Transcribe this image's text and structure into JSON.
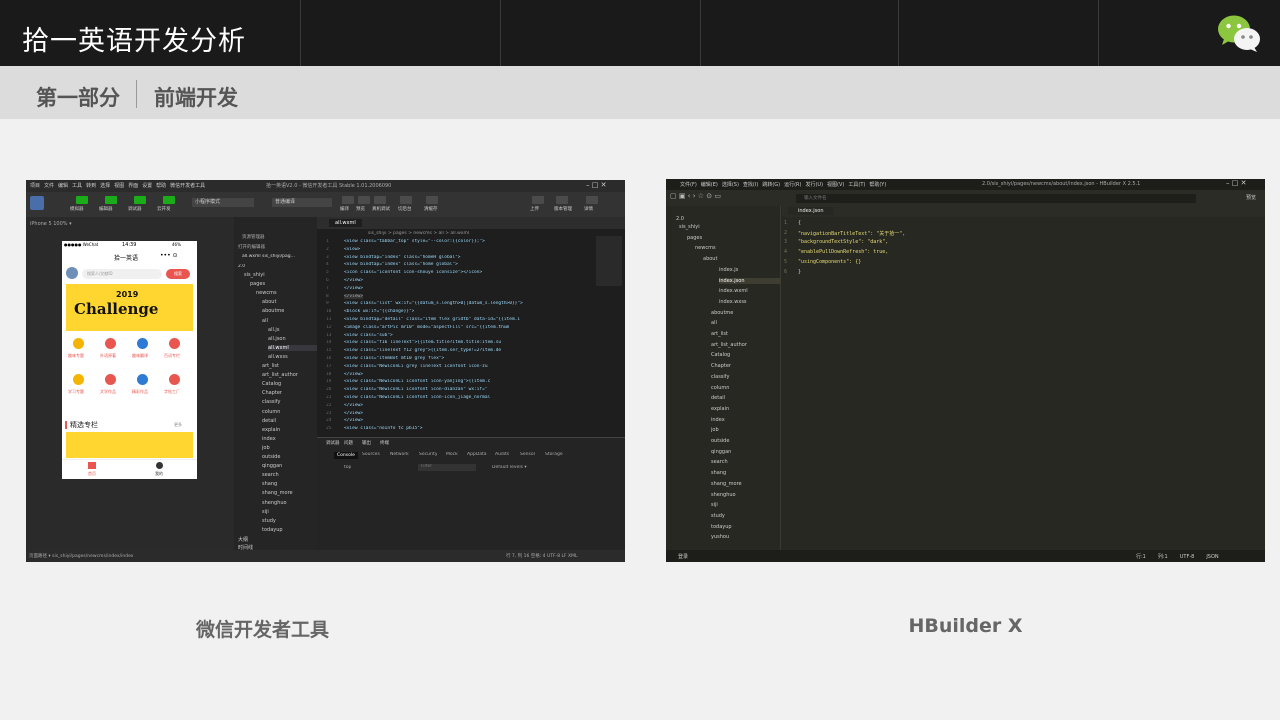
{
  "header": {
    "title": "拾一英语开发分析",
    "logo_icon": "wechat-icon"
  },
  "section": {
    "part": "第一部分",
    "topic": "前端开发"
  },
  "left_panel": {
    "caption": "微信开发者工具",
    "menu": [
      "项目",
      "文件",
      "编辑",
      "工具",
      "转到",
      "选择",
      "视图",
      "界面",
      "设置",
      "帮助",
      "微信开发者工具"
    ],
    "window_title": "拾一英语V2.0 - 微信开发者工具 Stable 1.01.2006090",
    "toolbar": [
      "模拟器",
      "编辑器",
      "调试器",
      "云开发"
    ],
    "mode_select": "小程序模式",
    "compile_select": "普通编译",
    "toolbar_right": [
      "编译",
      "预览",
      "真机调试",
      "切后台",
      "清缓存",
      "上传",
      "版本管理",
      "详情"
    ],
    "device": "iPhone 5 100% ▾",
    "file_tab": "all.wxml",
    "breadcrumb": "sis_shiyi > pages > newcms > all > all.wxml",
    "phone": {
      "status_left": "●●●●● WeChat",
      "time": "14:39",
      "battery": "46%",
      "app_title": "拾一英语",
      "search_placeholder": "搜索人/文献ID",
      "search_btn": "搜索",
      "banner_year": "2019",
      "banner_word": "Challenge",
      "icons_row1": [
        "趣味专题",
        "外语原著",
        "趣味翻译",
        "百词专栏"
      ],
      "icons_row2": [
        "学习专题",
        "文学作品",
        "精彩作品",
        "字帖工厂"
      ],
      "section_title": "精选专栏",
      "section_more": "更多",
      "tabbar": [
        "首页",
        "我的"
      ]
    },
    "tree_header": "资源管理器",
    "tree_open": "打开的编辑器",
    "tree_open_file": "all.wxml sis_shiyi/pag...",
    "tree_root": "2.0",
    "tree": [
      "sis_shiyi",
      "pages",
      "newcms",
      "about",
      "aboutme",
      "all",
      "all.js",
      "all.json",
      "all.wxml",
      "all.wxss",
      "art_list",
      "art_list_author",
      "Catalog",
      "Chapter",
      "classify",
      "column",
      "detail",
      "explain",
      "index",
      "job",
      "outside",
      "qinggan",
      "search",
      "shang",
      "shang_more",
      "shenghuo",
      "siji",
      "study",
      "todayup"
    ],
    "tree_bottom": [
      "大纲",
      "时间线"
    ],
    "code": [
      "<view class=\"tabbar_top\" style=\"--color:{{color}};\">",
      "  <view>",
      "    <view bindtap=\"index\" class=\"homeH global\">",
      "      <view bindtap=\"index\" class=\"home global\">",
      "        <icon class=\"iconfont icon-shouye iconsize\"></icon>",
      "      </view>",
      "    </view>",
      "  </view>",
      "<view class=\"list\" wx:if=\"{{datum_s.length>0||datum_s.length>0}}\">",
      "  <block wx:if=\"{{change}}\">",
      "    <view bindtap=\"detail\" class=\"item flex gridtb\" data-id=\"{{item.i",
      "      <image class=\"artPic mr10\" mode=\"aspectFill\" src=\"{{item.thum",
      "      <view class=\"sub\">",
      "        <view class=\"f16 lineText\">{{item.title?item.title:item.su",
      "        <view class=\"lineText f12 grey\">{{item.ser_type!=2?item.de",
      "        <view class=\"itemBot mt10 grey flex\">",
      "          <view class=\"NewiconLi grey lineText iconfont icon-zu",
      "          </view>",
      "          <view class=\"NewiconLi iconfont icon-yanjing\">{{item.c",
      "          <view class=\"NewiconLi iconfont icon-dianzan\" wx:if=\"",
      "          <view class=\"NewiconLi iconfont icon-icon_jiage_normal",
      "        </view>",
      "      </view>",
      "    </view>",
      "    <view class=\"noInfo tc pb15\">"
    ],
    "console_tabs": [
      "调试器",
      "问题",
      "输出",
      "终端"
    ],
    "devtools_tabs": [
      "Console",
      "Sources",
      "Network",
      "Security",
      "Mock",
      "AppData",
      "Audits",
      "Sensor",
      "Storage"
    ],
    "console_context": "top",
    "console_filter": "Filter",
    "console_levels": "Default levels ▾",
    "status_left": "页面路径 ▾  sis_shiyi/pages/newcms/index/index",
    "status_right": "行 7, 列 16   空格: 4   UTF-8   LF   XML"
  },
  "right_panel": {
    "caption": "HBuilder X",
    "menu": [
      "文件(F)",
      "编辑(E)",
      "选择(S)",
      "查找(I)",
      "跳转(G)",
      "运行(R)",
      "发行(U)",
      "视图(V)",
      "工具(T)",
      "帮助(Y)"
    ],
    "window_title": "2.0/sis_shiyi/pages/newcms/about/index.json - HBuilder X 2.5.1",
    "search_placeholder": "输入文件名",
    "preview_btn": "预览",
    "tab": "index.json",
    "tree_root": "2.0",
    "tree": [
      "sis_shiyi",
      "pages",
      "newcms",
      "about",
      "index.js",
      "index.json",
      "index.wxml",
      "index.wxss",
      "aboutme",
      "all",
      "art_list",
      "art_list_author",
      "Catalog",
      "Chapter",
      "classify",
      "column",
      "detail",
      "explain",
      "index",
      "job",
      "outside",
      "qinggan",
      "search",
      "shang",
      "shang_more",
      "shenghuo",
      "siji",
      "study",
      "todayup",
      "yushou"
    ],
    "code_lines": [
      {
        "t": "{",
        "c": "#d4d4d4"
      },
      {
        "t": "    \"navigationBarTitleText\": \"关于拾一\",",
        "c": "#e6db74"
      },
      {
        "t": "    \"backgroundTextStyle\": \"dark\",",
        "c": "#e6db74"
      },
      {
        "t": "    \"enablePullDownRefresh\": true,",
        "c": "#e6db74"
      },
      {
        "t": "    \"usingComponents\": {}",
        "c": "#e6db74"
      },
      {
        "t": "}",
        "c": "#d4d4d4"
      }
    ],
    "status_left": "登录",
    "status_right": [
      "行:1",
      "列:1",
      "UTF-8",
      "JSON"
    ]
  }
}
